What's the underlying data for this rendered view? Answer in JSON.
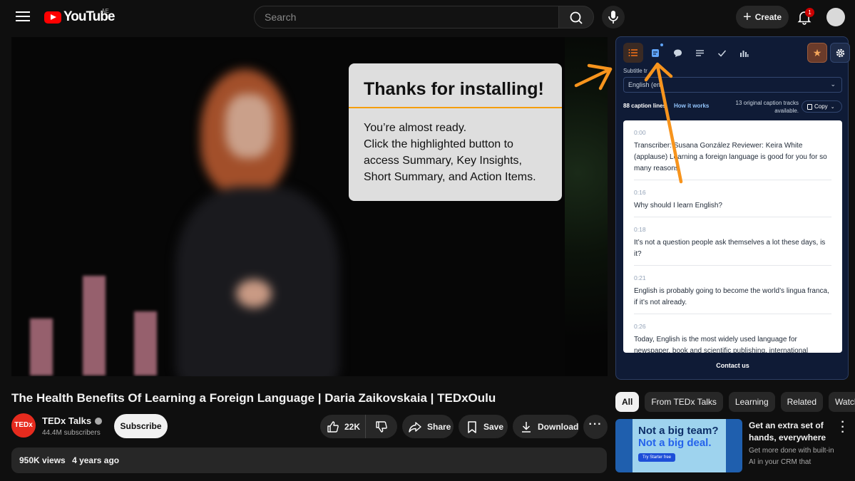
{
  "header": {
    "logo_text": "YouTube",
    "region": "AE",
    "search_placeholder": "Search",
    "create_label": "Create",
    "notification_count": "1"
  },
  "popup": {
    "title": "Thanks for installing!",
    "lines": [
      "You’re almost ready.",
      "Click the highlighted button to",
      "access Summary, Key Insights,",
      "Short Summary, and Action Items."
    ]
  },
  "video": {
    "title": "The Health Benefits Of Learning a Foreign Language | Daria Zaikovskaia | TEDxOulu",
    "channel_name": "TEDx Talks",
    "channel_avatar_text": "TEDx",
    "subscribers": "44.4M subscribers",
    "subscribe_label": "Subscribe",
    "likes": "22K",
    "share_label": "Share",
    "save_label": "Save",
    "download_label": "Download",
    "views": "950K views",
    "age": "4 years ago"
  },
  "extension": {
    "subtitle_label": "Subtitle tr",
    "track_value": "English (en)",
    "caption_count": "88 caption lines",
    "how_it_works": "How it works",
    "tracks_info": "13 original caption tracks available.",
    "copy_label": "Copy",
    "contact": "Contact us",
    "accent_color": "#f97316",
    "cues": [
      {
        "time": "0:00",
        "text": "Transcriber: Susana González Reviewer: Keira White (applause) Learning a foreign language is good for you for so many reasons."
      },
      {
        "time": "0:16",
        "text": "Why should I learn English?"
      },
      {
        "time": "0:18",
        "text": "It’s not a question people ask themselves a lot these days, is it?"
      },
      {
        "time": "0:21",
        "text": "English is probably going to become the world’s lingua franca, if it’s not already."
      },
      {
        "time": "0:26",
        "text": "Today, English is the most widely used language for newspaper, book and scientific publishing, international telecommunications, international trade, mass entertainment, diplomacy and, of course, the Internet."
      }
    ]
  },
  "chips": [
    "All",
    "From TEDx Talks",
    "Learning",
    "Related",
    "Watched"
  ],
  "ad": {
    "thumb_line1": "Not a big team?",
    "thumb_line2": "Not a big deal.",
    "thumb_cta": "Try Starter free",
    "title": "Get an extra set of hands, everywhere",
    "description": "Get more done with built-in AI in your CRM that"
  }
}
